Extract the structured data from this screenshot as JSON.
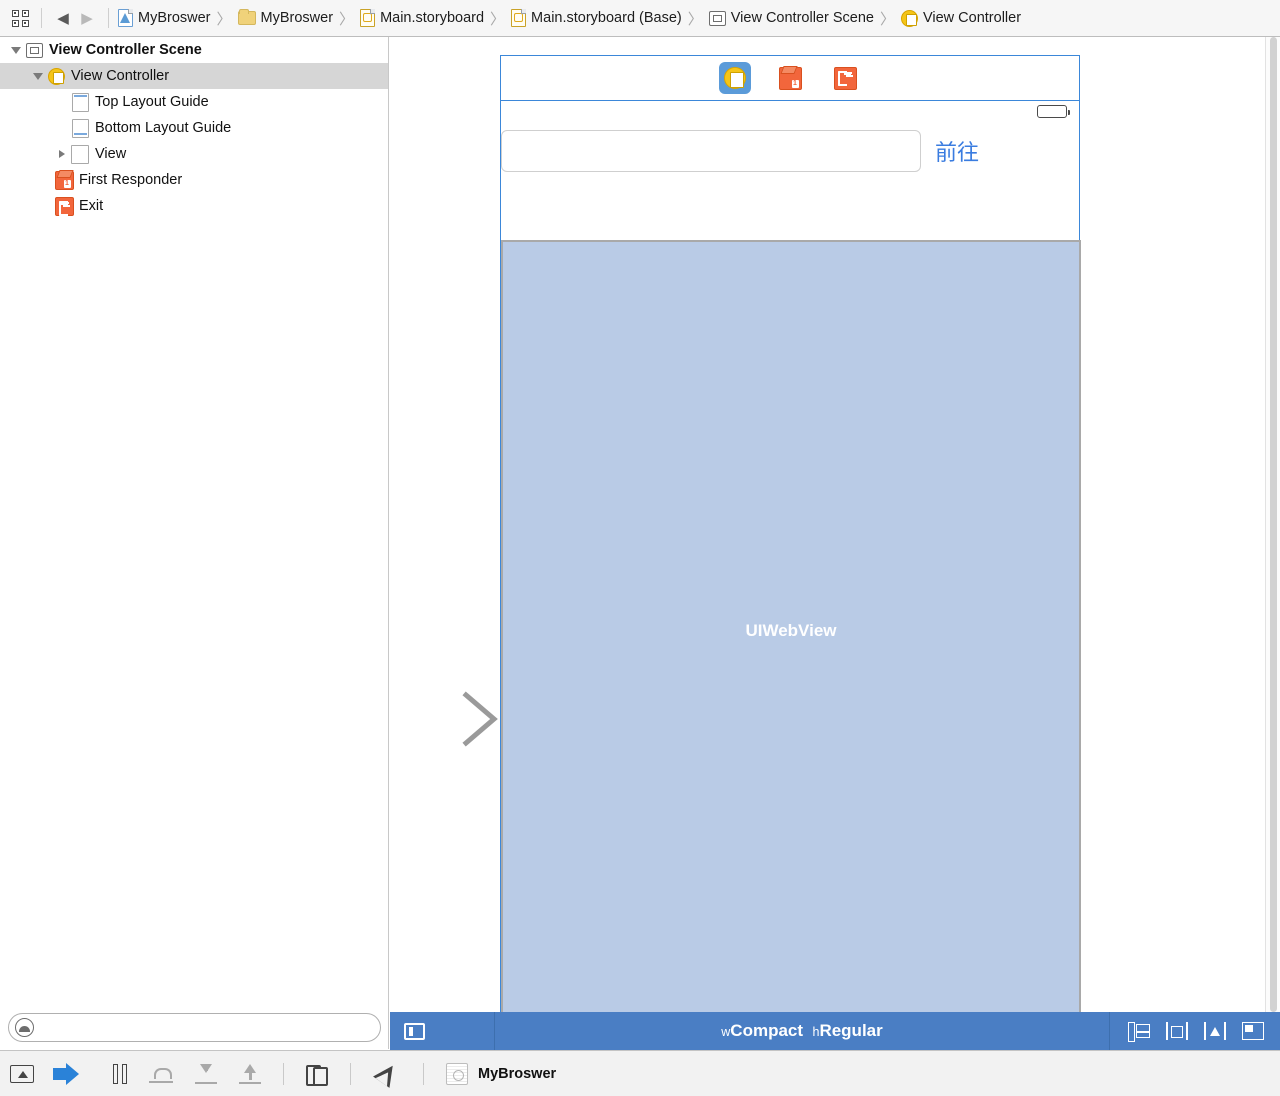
{
  "jumpbar": {
    "related_items_icon": "grid-icon",
    "back_label": "◀",
    "forward_label": "▶",
    "crumbs": [
      {
        "label": "MyBroswer",
        "icon": "app-file-icon"
      },
      {
        "label": "MyBroswer",
        "icon": "folder-icon"
      },
      {
        "label": "Main.storyboard",
        "icon": "storyboard-file-icon"
      },
      {
        "label": "Main.storyboard (Base)",
        "icon": "storyboard-file-icon"
      },
      {
        "label": "View Controller Scene",
        "icon": "scene-icon"
      },
      {
        "label": "View Controller",
        "icon": "view-controller-icon"
      }
    ],
    "separator": "〉"
  },
  "outline": {
    "rows": [
      {
        "label": "View Controller Scene",
        "icon": "scene-icon",
        "indent": 0,
        "disclosure": "open",
        "selected": false,
        "bold": true
      },
      {
        "label": "View Controller",
        "icon": "view-controller-icon",
        "indent": 1,
        "disclosure": "open",
        "selected": true,
        "bold": false
      },
      {
        "label": "Top Layout Guide",
        "icon": "top-layout-guide-icon",
        "indent": 2,
        "disclosure": "none",
        "selected": false,
        "bold": false
      },
      {
        "label": "Bottom Layout Guide",
        "icon": "bottom-layout-guide-icon",
        "indent": 2,
        "disclosure": "none",
        "selected": false,
        "bold": false
      },
      {
        "label": "View",
        "icon": "view-icon",
        "indent": 2,
        "disclosure": "closed",
        "selected": false,
        "bold": false
      },
      {
        "label": "First Responder",
        "icon": "first-responder-icon",
        "indent": 1,
        "disclosure": "none",
        "selected": false,
        "bold": false
      },
      {
        "label": "Exit",
        "icon": "exit-icon",
        "indent": 1,
        "disclosure": "none",
        "selected": false,
        "bold": false
      }
    ],
    "filter": {
      "value": "",
      "placeholder": ""
    }
  },
  "canvas": {
    "entry_point": "initial-view-controller-arrow",
    "scene_dock": [
      {
        "name": "view-controller",
        "icon": "view-controller-icon",
        "active": true
      },
      {
        "name": "first-responder",
        "icon": "first-responder-icon",
        "active": false
      },
      {
        "name": "exit",
        "icon": "exit-icon",
        "active": false
      }
    ],
    "device": {
      "statusbar": {
        "battery_icon": "battery-icon"
      },
      "url_field": {
        "value": "",
        "placeholder": ""
      },
      "go_button": "前往",
      "webview_label": "UIWebView"
    }
  },
  "sizeclass_bar": {
    "outline_toggle_icon": "document-outline-toggle-icon",
    "width_prefix": "w",
    "width_class": "Compact",
    "height_prefix": "h",
    "height_class": "Regular",
    "tools": [
      {
        "name": "stack-button",
        "icon": "stack-icon"
      },
      {
        "name": "align-button",
        "icon": "align-icon"
      },
      {
        "name": "pin-button",
        "icon": "pin-icon"
      },
      {
        "name": "resolve-issues-button",
        "icon": "resolve-issues-icon"
      }
    ]
  },
  "debugbar": {
    "buttons": [
      {
        "name": "toggle-console-button",
        "icon": "console-icon"
      },
      {
        "name": "continue-button",
        "icon": "continue-icon"
      },
      {
        "name": "pause-button",
        "icon": "pause-icon"
      },
      {
        "name": "step-over-button",
        "icon": "step-over-icon"
      },
      {
        "name": "step-into-button",
        "icon": "step-into-icon"
      },
      {
        "name": "step-out-button",
        "icon": "step-out-icon"
      },
      {
        "name": "view-hierarchy-button",
        "icon": "view-hierarchy-icon"
      },
      {
        "name": "simulate-location-button",
        "icon": "location-arrow-icon"
      }
    ],
    "process_icon": "process-icon",
    "process_label": "MyBroswer"
  },
  "colors": {
    "scene_border": "#3b87d9",
    "sizeclass_bar": "#4a7ec4",
    "webview_fill": "#b9cbe6",
    "go_button": "#3a7ce0",
    "accent_orange": "#f2663c",
    "accent_yellow": "#f5c518",
    "selection_gray": "#d6d6d6"
  }
}
